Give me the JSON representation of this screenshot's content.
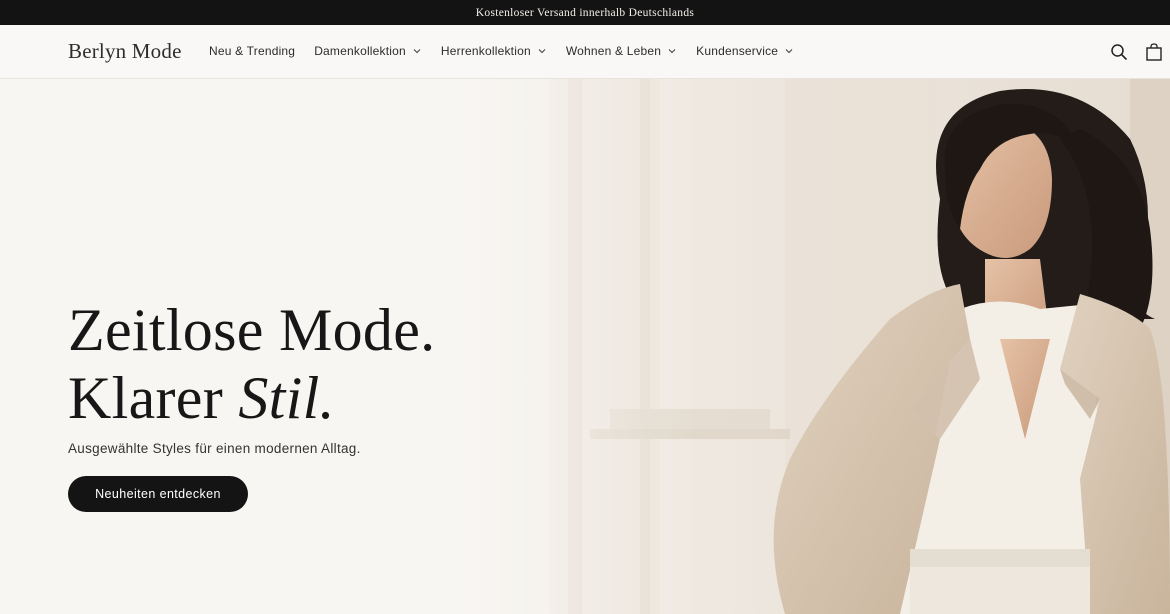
{
  "announcement": {
    "text": "Kostenloser Versand innerhalb Deutschlands"
  },
  "header": {
    "logo": "Berlyn Mode",
    "nav": [
      {
        "label": "Neu & Trending",
        "has_dropdown": false
      },
      {
        "label": "Damenkollektion",
        "has_dropdown": true
      },
      {
        "label": "Herrenkollektion",
        "has_dropdown": true
      },
      {
        "label": "Wohnen & Leben",
        "has_dropdown": true
      },
      {
        "label": "Kundenservice",
        "has_dropdown": true
      }
    ],
    "icons": [
      "search-icon",
      "cart-icon"
    ]
  },
  "hero": {
    "headline_line1": "Zeitlose Mode.",
    "headline_line2_plain": "Klarer ",
    "headline_line2_italic": "Stil.",
    "subtitle": "Ausgewählte Styles für einen modernen Alltag.",
    "cta_label": "Neuheiten entdecken"
  },
  "colors": {
    "announcement_bg": "#131313",
    "page_bg": "#f7f5f2",
    "button_bg": "#141414",
    "coat": "#d8c6b1",
    "blouse": "#f4efe6"
  }
}
